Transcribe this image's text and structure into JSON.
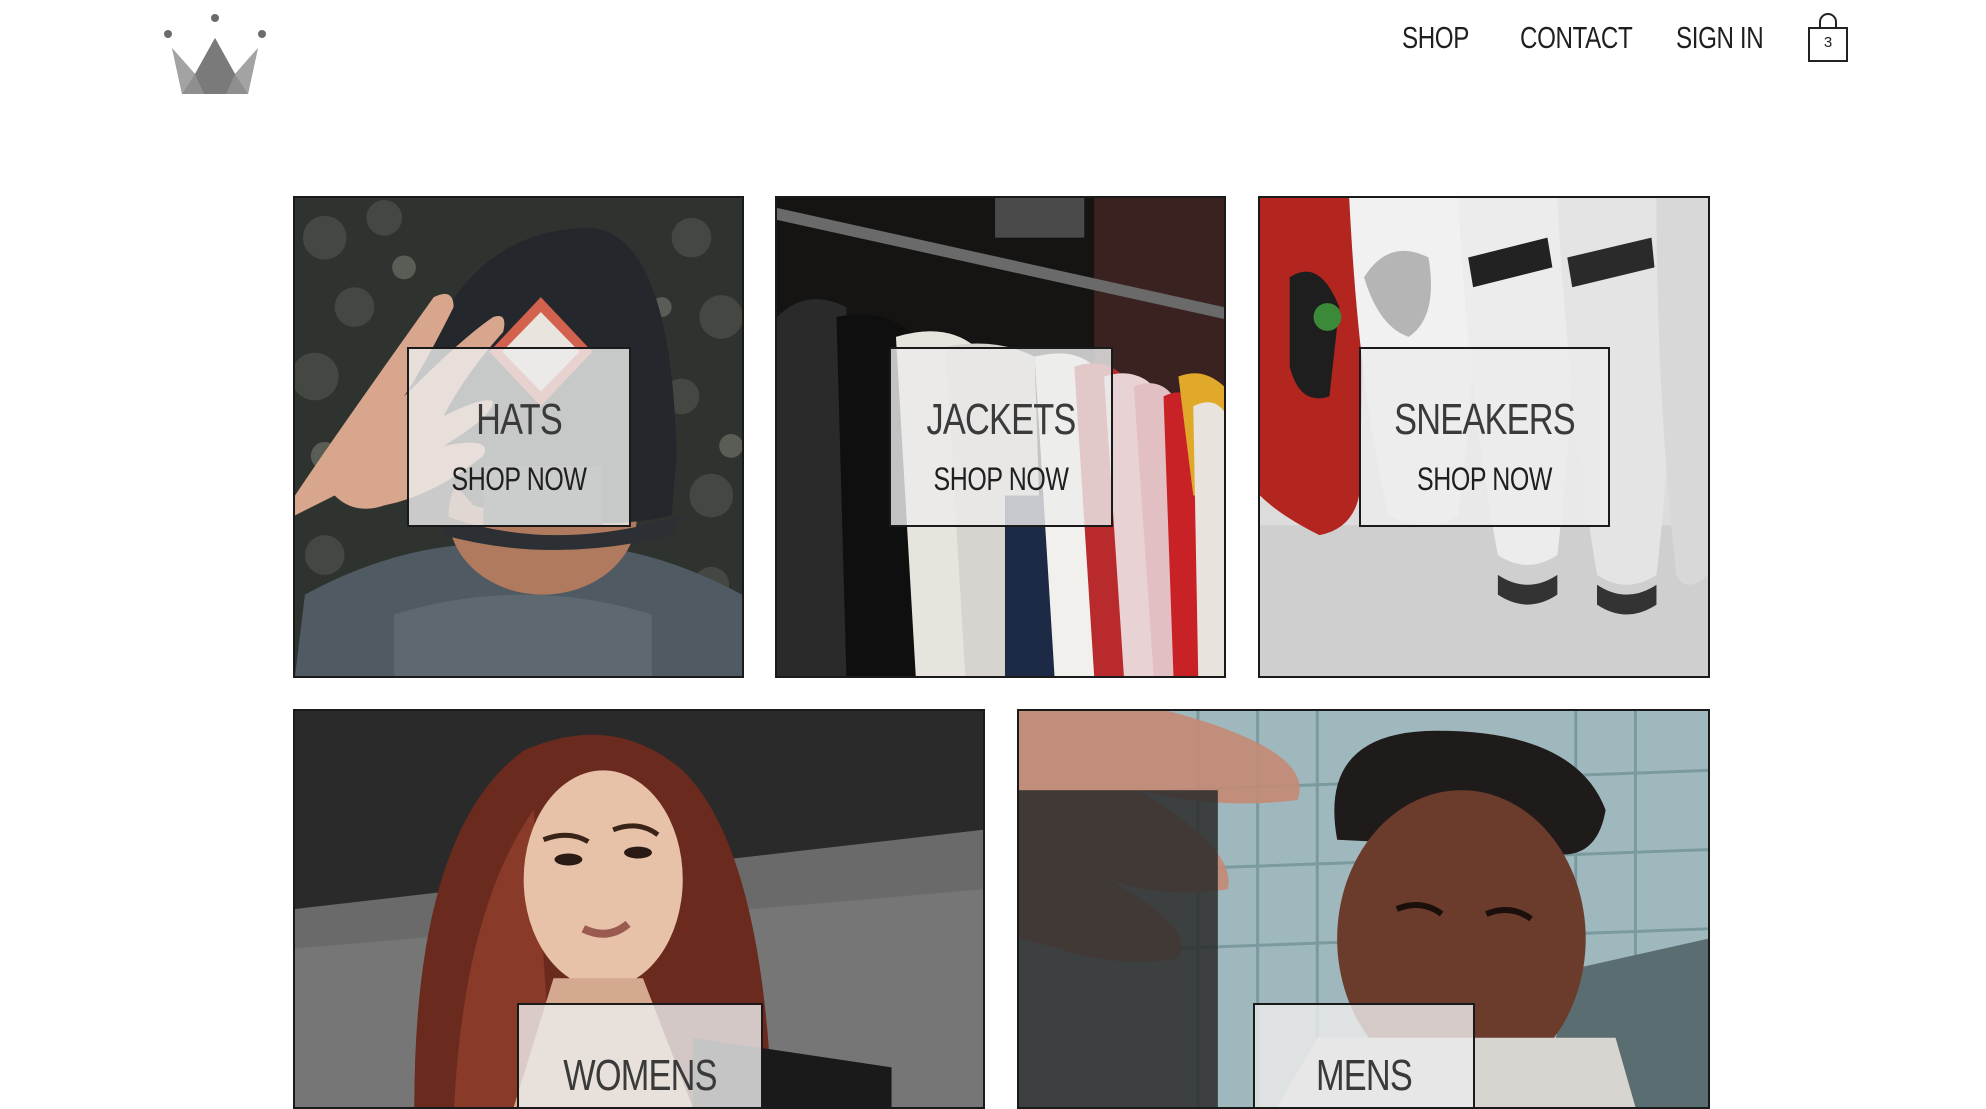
{
  "header": {
    "logo_icon": "crown-icon",
    "nav": {
      "shop": "SHOP",
      "contact": "CONTACT",
      "sign_in": "SIGN IN"
    },
    "cart": {
      "icon": "shopping-bag-icon",
      "count": "3"
    }
  },
  "directory": {
    "hats": {
      "title": "HATS",
      "cta": "SHOP NOW"
    },
    "jackets": {
      "title": "JACKETS",
      "cta": "SHOP NOW"
    },
    "sneakers": {
      "title": "SNEAKERS",
      "cta": "SHOP NOW"
    },
    "womens": {
      "title": "WOMENS"
    },
    "mens": {
      "title": "MENS"
    }
  },
  "colors": {
    "text": "#1f1f1f",
    "border": "#1a1a1a",
    "label_bg": "#ececec",
    "logo": "#7a7a7a"
  }
}
